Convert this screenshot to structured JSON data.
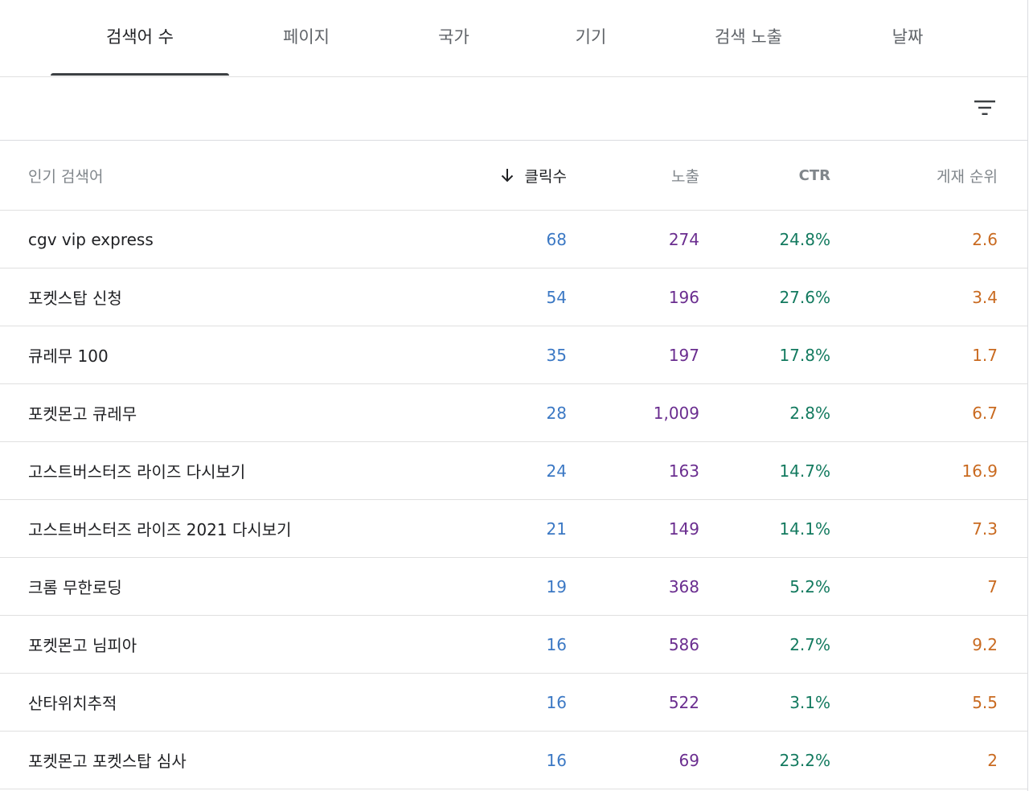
{
  "tabs": [
    {
      "label": "검색어 수",
      "active": true
    },
    {
      "label": "페이지",
      "active": false
    },
    {
      "label": "국가",
      "active": false
    },
    {
      "label": "기기",
      "active": false
    },
    {
      "label": "검색 노출",
      "active": false
    },
    {
      "label": "날짜",
      "active": false
    }
  ],
  "filter": {
    "icon": "filter-list-icon"
  },
  "table": {
    "headers": {
      "query": "인기 검색어",
      "clicks": "클릭수",
      "impressions": "노출",
      "ctr": "CTR",
      "position": "게재 순위"
    },
    "sort_icon": "arrow-down-icon",
    "rows": [
      {
        "query": "cgv vip express",
        "clicks": "68",
        "impressions": "274",
        "ctr": "24.8%",
        "position": "2.6"
      },
      {
        "query": "포켓스탑 신청",
        "clicks": "54",
        "impressions": "196",
        "ctr": "27.6%",
        "position": "3.4"
      },
      {
        "query": "큐레무 100",
        "clicks": "35",
        "impressions": "197",
        "ctr": "17.8%",
        "position": "1.7"
      },
      {
        "query": "포켓몬고 큐레무",
        "clicks": "28",
        "impressions": "1,009",
        "ctr": "2.8%",
        "position": "6.7"
      },
      {
        "query": "고스트버스터즈 라이즈 다시보기",
        "clicks": "24",
        "impressions": "163",
        "ctr": "14.7%",
        "position": "16.9"
      },
      {
        "query": "고스트버스터즈 라이즈 2021 다시보기",
        "clicks": "21",
        "impressions": "149",
        "ctr": "14.1%",
        "position": "7.3"
      },
      {
        "query": "크롬 무한로딩",
        "clicks": "19",
        "impressions": "368",
        "ctr": "5.2%",
        "position": "7"
      },
      {
        "query": "포켓몬고 님피아",
        "clicks": "16",
        "impressions": "586",
        "ctr": "2.7%",
        "position": "9.2"
      },
      {
        "query": "산타위치추적",
        "clicks": "16",
        "impressions": "522",
        "ctr": "3.1%",
        "position": "5.5"
      },
      {
        "query": "포켓몬고 포켓스탑 심사",
        "clicks": "16",
        "impressions": "69",
        "ctr": "23.2%",
        "position": "2"
      }
    ]
  },
  "colors": {
    "clicks": "#3b78c4",
    "impressions": "#6a2d8f",
    "ctr": "#137a5f",
    "position": "#c96a20"
  }
}
